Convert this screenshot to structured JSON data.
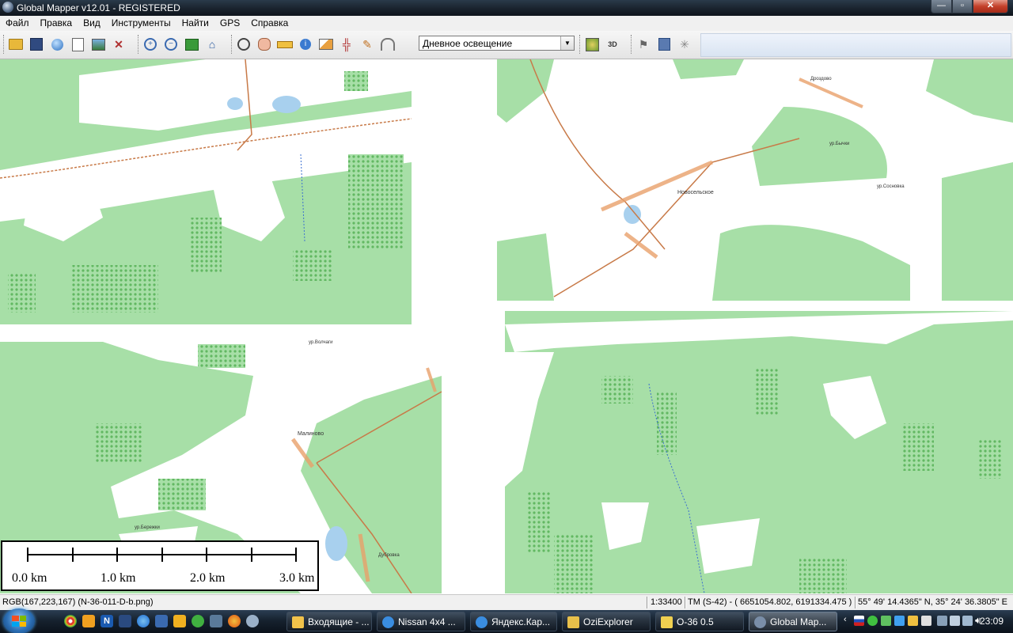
{
  "window": {
    "title": "Global Mapper v12.01 - REGISTERED",
    "minimize_glyph": "—",
    "maximize_glyph": "▫",
    "close_glyph": "✕"
  },
  "menu": [
    "Файл",
    "Правка",
    "Вид",
    "Инструменты",
    "Найти",
    "GPS",
    "Справка"
  ],
  "toolbar": {
    "groups": [
      [
        "open-folder-icon",
        "save-icon",
        "globe-icon",
        "catalog-icon",
        "layers-icon",
        "config-tools-icon"
      ],
      [
        "zoom-in-icon",
        "zoom-out-icon",
        "full-view-icon",
        "home-icon"
      ],
      [
        "zoom-tool-icon",
        "pan-hand-icon",
        "measure-icon",
        "info-tool-icon",
        "path-profile-icon",
        "digitizer-icon",
        "pencil-icon",
        "view-shed-icon"
      ],
      [
        "shader-icon",
        "3d-view-icon"
      ],
      [
        "flag-icon",
        "export-icon",
        "gps-icon"
      ]
    ],
    "lighting_select": {
      "value": "Дневное освещение"
    }
  },
  "map": {
    "colors": {
      "forest": "#a7dfa7",
      "open": "#ffffff",
      "road": "#c87a48",
      "water": "#a8d0ee",
      "stream": "#3b6fd0",
      "town": "#e8a06a"
    },
    "labels": [
      {
        "text": "Новосельское"
      },
      {
        "text": "Малиново"
      },
      {
        "text": "Дроздово"
      },
      {
        "text": "ур.Бычки"
      },
      {
        "text": "ур.Сосновка"
      },
      {
        "text": "ур.Волчаги"
      },
      {
        "text": "ур.Бережки"
      },
      {
        "text": "Дубровка"
      }
    ]
  },
  "scale": {
    "labels": [
      "0.0 km",
      "1.0 km",
      "2.0 km",
      "3.0 km"
    ]
  },
  "status": {
    "color": "RGB(167,223,167) (N-36-011-D-b.png)",
    "scale": "1:33400",
    "projection": "TM (S-42) - ( 6651054.802, 6191334.475 )",
    "latlon": "55° 49' 14.4365\" N, 35° 24' 36.3805\" E"
  },
  "taskbar": {
    "tasks": [
      {
        "label": "Входящие - ...",
        "icon_color": "#f1c24a"
      },
      {
        "label": "Nissan 4x4 ...",
        "icon_color": "#3a8de0"
      },
      {
        "label": "Яндекс.Кар...",
        "icon_color": "#3a8de0"
      },
      {
        "label": "OziExplorer",
        "icon_color": "#e8c04a"
      },
      {
        "label": "O-36 0.5",
        "icon_color": "#f0d050"
      },
      {
        "label": "Global Map...",
        "icon_color": "#7a8ea8",
        "active": true
      }
    ],
    "clock": "23:09"
  }
}
